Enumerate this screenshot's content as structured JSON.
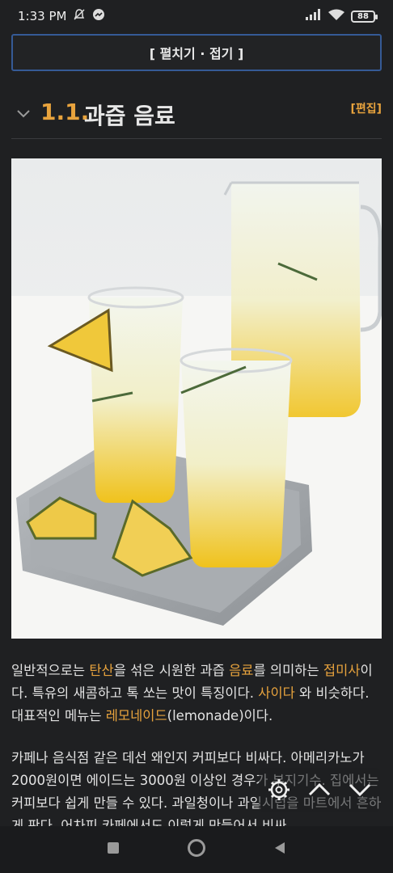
{
  "status": {
    "time": "1:33 PM",
    "battery": "88"
  },
  "fold_toggle": "[ 펼치기 · 접기 ]",
  "section": {
    "number": "1.1.",
    "title": "과즙 음료",
    "edit": "[편집]"
  },
  "article": {
    "p1": [
      {
        "t": "일반적으로는 "
      },
      {
        "t": "탄산",
        "link": true
      },
      {
        "t": "을 섞은 시원한 과즙 "
      },
      {
        "t": "음료",
        "link": true
      },
      {
        "t": "를 의미하는 "
      },
      {
        "t": "접미사",
        "link": true
      },
      {
        "t": "이다. 특유의 새콤하고 톡 쏘는 맛이 특징이다. "
      },
      {
        "t": "사이다",
        "link": true
      },
      {
        "t": " 와 비슷하다. 대표적인 메뉴는 "
      },
      {
        "t": "레모네이드",
        "link": true
      },
      {
        "t": "(lemonade)이다."
      }
    ],
    "p2": "카페나 음식점 같은 데선 왜인지 커피보다 비싸다. 아메리카노가 2000원이면 에이드는 3000원 이상인 경우가 부지기수. 집에서는 커피보다 쉽게 만들 수 있다. 과일청이나 과일시럽을 마트에서 흔하게 판다. 어차피 카페에서도 이렇게 만들어서 비싸"
  },
  "icons": {
    "status": [
      "dnd-off-icon",
      "messenger-icon",
      "signal-icon",
      "wifi-icon",
      "battery-icon"
    ],
    "float": [
      "settings-gear-icon",
      "scroll-up-icon",
      "scroll-down-icon"
    ],
    "nav": [
      "recents-square-icon",
      "home-circle-icon",
      "back-triangle-icon"
    ]
  },
  "colors": {
    "accent": "#e8a33d",
    "background": "#1f2022",
    "fold_border": "#355a96"
  }
}
